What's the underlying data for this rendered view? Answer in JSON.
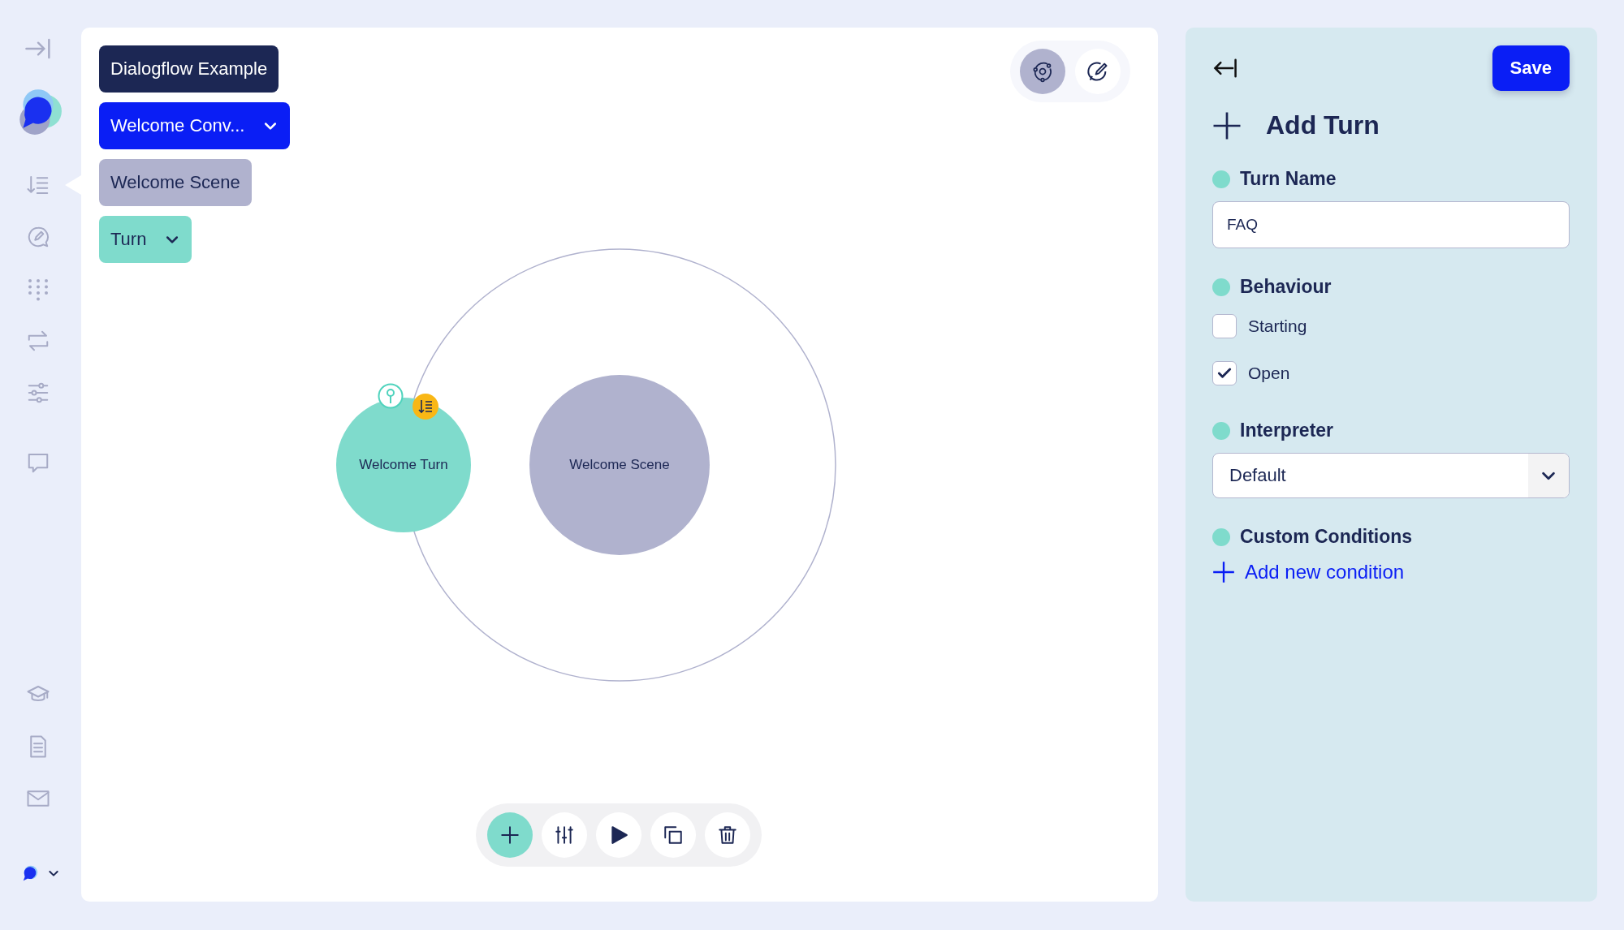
{
  "sidebar": {
    "items": [
      {
        "kind": "list",
        "selected": true
      },
      {
        "kind": "chat-edit",
        "selected": false
      },
      {
        "kind": "dots",
        "selected": false
      },
      {
        "kind": "repeat",
        "selected": false
      },
      {
        "kind": "sliders",
        "selected": false
      },
      {
        "kind": "message",
        "selected": false
      },
      {
        "kind": "graduation",
        "selected": false
      },
      {
        "kind": "document",
        "selected": false
      },
      {
        "kind": "mail",
        "selected": false
      }
    ]
  },
  "breadcrumbs": [
    {
      "label": "Dialogflow Example",
      "kind": "project",
      "dropdown": false
    },
    {
      "label": "Welcome Conv...",
      "kind": "conversation",
      "dropdown": true
    },
    {
      "label": "Welcome Scene",
      "kind": "scene",
      "dropdown": false
    },
    {
      "label": "Turn",
      "kind": "turn",
      "dropdown": true
    }
  ],
  "view_toggle": [
    {
      "kind": "graph",
      "selected": true
    },
    {
      "kind": "edit",
      "selected": false
    }
  ],
  "graph": {
    "nodes": [
      {
        "label": "Welcome Turn",
        "kind": "turn"
      },
      {
        "label": "Welcome Scene",
        "kind": "scene"
      }
    ]
  },
  "toolbar": [
    {
      "kind": "add"
    },
    {
      "kind": "sliders"
    },
    {
      "kind": "play"
    },
    {
      "kind": "copy"
    },
    {
      "kind": "delete"
    }
  ],
  "panel": {
    "title": "Add Turn",
    "save": "Save",
    "fields": [
      {
        "kind": "text",
        "label": "Turn Name",
        "value": "FAQ"
      },
      {
        "kind": "checkboxes",
        "label": "Behaviour",
        "options": [
          {
            "label": "Starting",
            "checked": false
          },
          {
            "label": "Open",
            "checked": true
          }
        ]
      },
      {
        "kind": "select",
        "label": "Interpreter",
        "value": "Default"
      },
      {
        "kind": "link",
        "label": "Custom Conditions",
        "link": "Add new condition"
      }
    ]
  }
}
